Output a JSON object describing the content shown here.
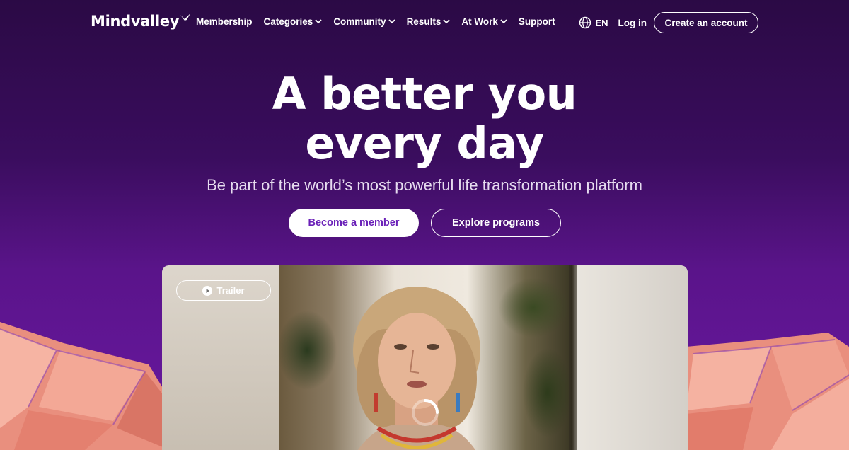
{
  "brand": {
    "name": "Mindvalley"
  },
  "nav": {
    "items": [
      {
        "label": "Membership",
        "dropdown": false
      },
      {
        "label": "Categories",
        "dropdown": true
      },
      {
        "label": "Community",
        "dropdown": true
      },
      {
        "label": "Results",
        "dropdown": true
      },
      {
        "label": "At Work",
        "dropdown": true
      },
      {
        "label": "Support",
        "dropdown": false
      }
    ],
    "language": "EN",
    "login_label": "Log in",
    "create_account_label": "Create an account"
  },
  "hero": {
    "title_line1": "A better you",
    "title_line2": "every day",
    "subtitle": "Be part of the world’s most powerful life transformation platform",
    "primary_cta": "Become a member",
    "secondary_cta": "Explore programs"
  },
  "video": {
    "trailer_label": "Trailer",
    "state": "loading"
  },
  "colors": {
    "background_top": "#2b0a45",
    "background_bottom": "#6a18a2",
    "primary_button_text": "#6a20b8",
    "crystal": "#f0a394"
  },
  "icons": {
    "globe": "globe-icon",
    "chevron": "chevron-down-icon",
    "play": "play-icon",
    "spinner": "loading-spinner"
  }
}
